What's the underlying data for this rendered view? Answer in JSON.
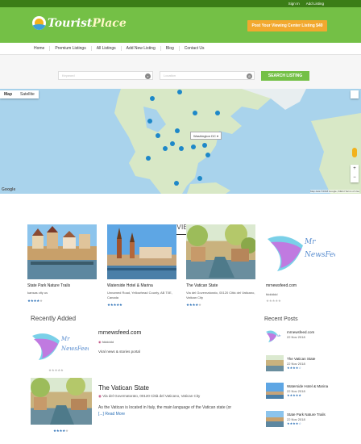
{
  "topbar": {
    "signin": "Sign In",
    "add_listing": "Add Listing"
  },
  "brand": {
    "name_part1": "Tourist",
    "name_part2": "Place",
    "cta": "Post Your Viewing Center Listing $40"
  },
  "nav": [
    "Home",
    "Premium Listings",
    "All Listings",
    "Add New Listing",
    "Blog",
    "Contact Us"
  ],
  "search": {
    "keyword_placeholder": "Keyword",
    "location_placeholder": "Location",
    "button": "SEARCH LISTING"
  },
  "map": {
    "tab_map": "Map",
    "tab_satellite": "Satellite",
    "popup": "Washington DC",
    "google": "Google",
    "footer": "Map data ©2018 Google, INEGI  Terms of Use",
    "colors": {
      "water": "#a9d3ec",
      "land": "#d8e8c6",
      "pin": "#1e88c8"
    }
  },
  "premium": {
    "title": "FIND PREMIUM VIEWING CENTER",
    "cards": [
      {
        "title": "State Park Nature Trails",
        "address": "kansas city us",
        "stars": 4,
        "image": "riverside-town"
      },
      {
        "title": "Waterside Hotel & Marina",
        "address": "Unnamed Road, Yellowhead County, AB T0E, Canada",
        "stars": 5,
        "image": "church-harbor"
      },
      {
        "title": "The Vatican State",
        "address": "Via del Governatorato, 00120 Città del Vaticano, Vatican City",
        "stars": 4,
        "image": "canal-trees"
      },
      {
        "title": "mrnewsfeed.com",
        "address": "fdddddd",
        "stars": 0,
        "image": "mrnewsfeed-logo"
      }
    ]
  },
  "recent": {
    "title": "Recently Added",
    "items": [
      {
        "title": "mrnewsfeed.com",
        "location": "fdddddd",
        "desc": "Viral news & stories portal",
        "stars": 0
      },
      {
        "title": "The Vatican State",
        "location": "Via del Governatorato, 00120 Città del Vaticano, Vatican City",
        "desc": "As the Vatican is located in Italy, the main language of the Vatican state (or",
        "more": "[...] Read More",
        "stars": 4
      }
    ]
  },
  "recent_posts": {
    "title": "Recent Posts",
    "items": [
      {
        "title": "mrnewsfeed.com",
        "date": "22 Nov 2018",
        "stars": ""
      },
      {
        "title": "The Vatican State",
        "date": "22 Nov 2018",
        "stars": "★★★★☆"
      },
      {
        "title": "Waterside Hotel & Marina",
        "date": "22 Nov 2018",
        "stars": "★★★★★"
      },
      {
        "title": "State Park Nature Trails",
        "date": "22 Nov 2018",
        "stars": "★★★★☆"
      }
    ]
  },
  "logo_text": {
    "mr": "Mr",
    "newsfeed": "NewsFeed"
  }
}
